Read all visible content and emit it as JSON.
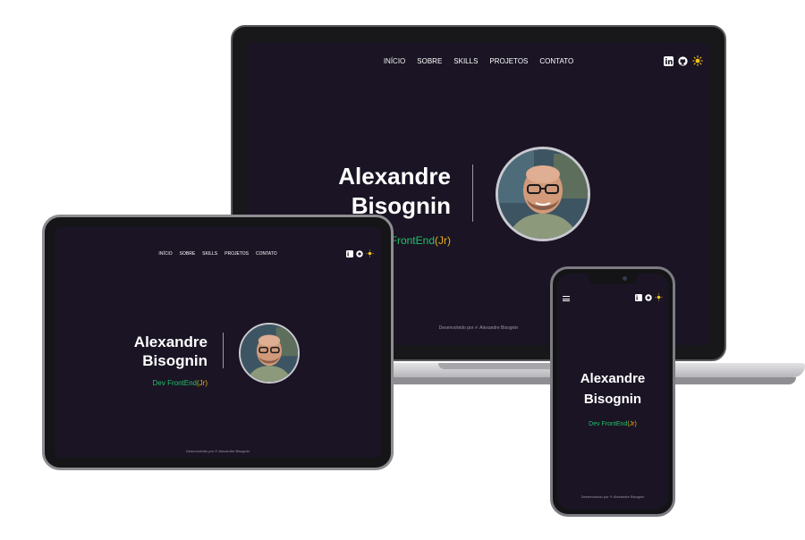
{
  "nav": {
    "items": [
      "INÍCIO",
      "SOBRE",
      "SKILLS",
      "PROJETOS",
      "CONTATO"
    ]
  },
  "hero": {
    "first_name": "Alexandre",
    "last_name": "Bisognin",
    "role_main": "Dev FrontEnd",
    "role_suffix": "(Jr)"
  },
  "footer": {
    "text_prefix": "Desenvolvido por",
    "author": "Alexandre Bisognin"
  },
  "colors": {
    "background": "#1a1424",
    "accent_green": "#21c16a",
    "accent_yellow": "#e8b21a"
  },
  "icons": [
    "linkedin-icon",
    "github-icon",
    "sun-icon",
    "hamburger-menu-icon"
  ]
}
